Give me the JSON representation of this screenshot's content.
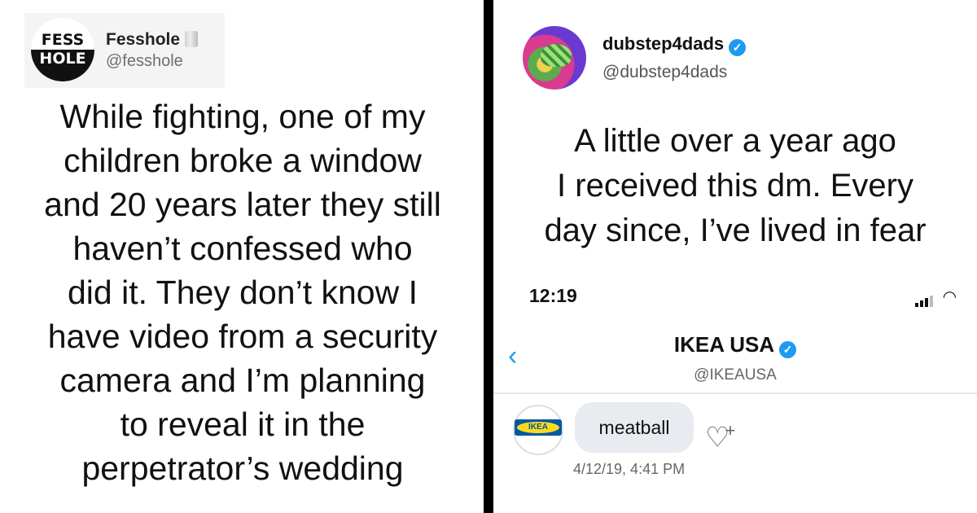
{
  "left_tweet": {
    "logo_line1": "FESS",
    "logo_line2": "HOLE",
    "name": "Fesshole",
    "name_icon": "toilet-roll-icon",
    "handle": "@fesshole",
    "text_lines": [
      "While fighting, one of my",
      "children broke a window",
      "and 20 years later they still",
      "haven’t confessed who",
      "did it. They don’t know I",
      "have video from a security",
      "camera and I’m planning",
      "to reveal it in the",
      "perpetrator’s wedding"
    ]
  },
  "right_tweet": {
    "name": "dubstep4dads",
    "verified_icon": "verified-badge-icon",
    "handle": "@dubstep4dads",
    "text_lines": [
      "A little over a year ago",
      "I received this dm. Every",
      "day since, I’ve lived in fear"
    ]
  },
  "dm_screenshot": {
    "status_time": "12:19",
    "back_icon": "chevron-left-icon",
    "contact_name": "IKEA USA",
    "contact_handle": "@IKEAUSA",
    "ikea_logo_text": "IKEA",
    "message": "meatball",
    "message_time": "4/12/19, 4:41 PM",
    "like_icon": "heart-plus-icon"
  },
  "colors": {
    "accent_blue": "#1d9bf0",
    "divider": "#000000",
    "bubble": "#e8ebef"
  }
}
